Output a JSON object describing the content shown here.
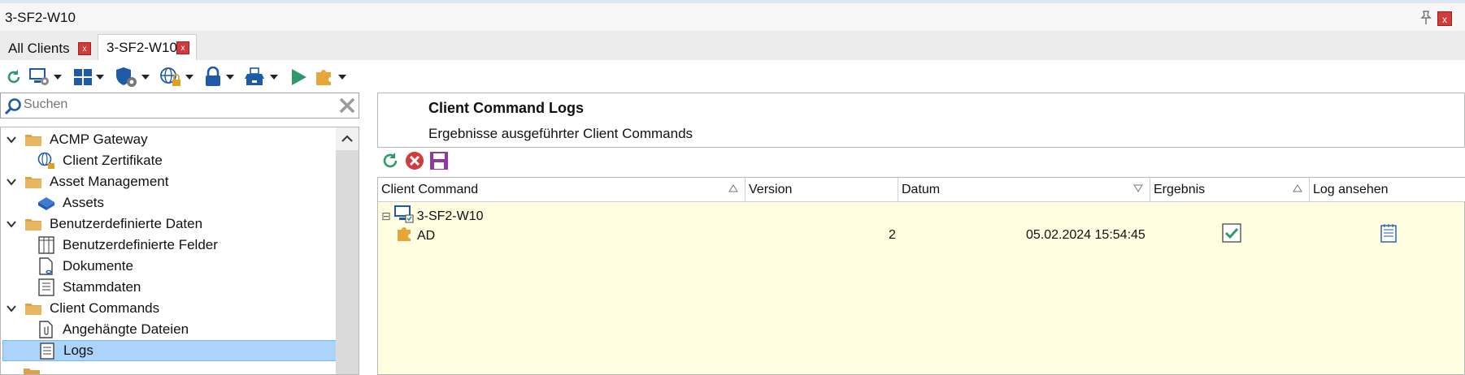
{
  "window": {
    "title": "3-SF2-W10",
    "close_label": "x"
  },
  "tabs": [
    {
      "label": "All Clients",
      "close_label": "x"
    },
    {
      "label": "3-SF2-W10",
      "close_label": "x"
    }
  ],
  "toolbar": {
    "icons": [
      "refresh-icon",
      "client-settings-icon",
      "windows-icon",
      "security-settings-icon",
      "network-lock-icon",
      "lock-icon",
      "remote-tools-icon",
      "play-icon",
      "plugin-icon"
    ]
  },
  "search": {
    "placeholder": "Suchen",
    "value": ""
  },
  "tree": {
    "items": [
      {
        "label": "ACMP Gateway",
        "type": "folder",
        "expanded": true
      },
      {
        "label": "Client Zertifikate",
        "type": "item"
      },
      {
        "label": "Asset Management",
        "type": "folder",
        "expanded": true
      },
      {
        "label": "Assets",
        "type": "item"
      },
      {
        "label": "Benutzerdefinierte Daten",
        "type": "folder",
        "expanded": true
      },
      {
        "label": "Benutzerdefinierte Felder",
        "type": "item"
      },
      {
        "label": "Dokumente",
        "type": "item"
      },
      {
        "label": "Stammdaten",
        "type": "item"
      },
      {
        "label": "Client Commands",
        "type": "folder",
        "expanded": true
      },
      {
        "label": "Angehängte Dateien",
        "type": "item"
      },
      {
        "label": "Logs",
        "type": "item",
        "selected": true
      }
    ]
  },
  "panel": {
    "title": "Client Command Logs",
    "subtitle": "Ergebnisse ausgeführter Client Commands"
  },
  "grid": {
    "columns": [
      "Client Command",
      "Version",
      "Datum",
      "Ergebnis",
      "Log ansehen"
    ],
    "group": {
      "label": "3-SF2-W10",
      "collapse_glyph": "⊟"
    },
    "rows": [
      {
        "command": "AD",
        "version": "2",
        "datum": "05.02.2024 15:54:45",
        "ergebnis": "success",
        "log": "view-log"
      }
    ]
  },
  "colors": {
    "selection": "#aad4fb",
    "grid_bg": "#fffee0",
    "close_red": "#d23b3b",
    "accent_green": "#2e9a6b"
  }
}
